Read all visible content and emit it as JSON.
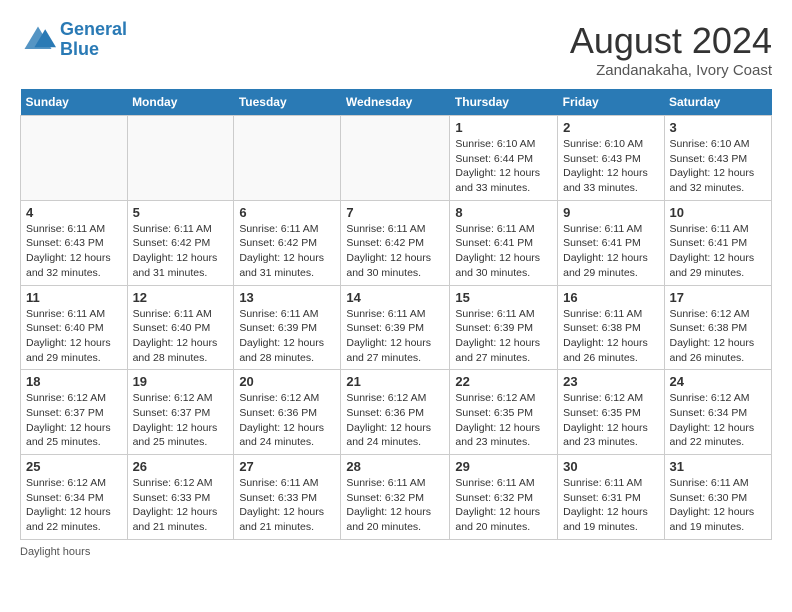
{
  "header": {
    "logo_line1": "General",
    "logo_line2": "Blue",
    "month": "August 2024",
    "location": "Zandanakaha, Ivory Coast"
  },
  "days_of_week": [
    "Sunday",
    "Monday",
    "Tuesday",
    "Wednesday",
    "Thursday",
    "Friday",
    "Saturday"
  ],
  "weeks": [
    [
      {
        "day": "",
        "info": ""
      },
      {
        "day": "",
        "info": ""
      },
      {
        "day": "",
        "info": ""
      },
      {
        "day": "",
        "info": ""
      },
      {
        "day": "1",
        "info": "Sunrise: 6:10 AM\nSunset: 6:44 PM\nDaylight: 12 hours\nand 33 minutes."
      },
      {
        "day": "2",
        "info": "Sunrise: 6:10 AM\nSunset: 6:43 PM\nDaylight: 12 hours\nand 33 minutes."
      },
      {
        "day": "3",
        "info": "Sunrise: 6:10 AM\nSunset: 6:43 PM\nDaylight: 12 hours\nand 32 minutes."
      }
    ],
    [
      {
        "day": "4",
        "info": "Sunrise: 6:11 AM\nSunset: 6:43 PM\nDaylight: 12 hours\nand 32 minutes."
      },
      {
        "day": "5",
        "info": "Sunrise: 6:11 AM\nSunset: 6:42 PM\nDaylight: 12 hours\nand 31 minutes."
      },
      {
        "day": "6",
        "info": "Sunrise: 6:11 AM\nSunset: 6:42 PM\nDaylight: 12 hours\nand 31 minutes."
      },
      {
        "day": "7",
        "info": "Sunrise: 6:11 AM\nSunset: 6:42 PM\nDaylight: 12 hours\nand 30 minutes."
      },
      {
        "day": "8",
        "info": "Sunrise: 6:11 AM\nSunset: 6:41 PM\nDaylight: 12 hours\nand 30 minutes."
      },
      {
        "day": "9",
        "info": "Sunrise: 6:11 AM\nSunset: 6:41 PM\nDaylight: 12 hours\nand 29 minutes."
      },
      {
        "day": "10",
        "info": "Sunrise: 6:11 AM\nSunset: 6:41 PM\nDaylight: 12 hours\nand 29 minutes."
      }
    ],
    [
      {
        "day": "11",
        "info": "Sunrise: 6:11 AM\nSunset: 6:40 PM\nDaylight: 12 hours\nand 29 minutes."
      },
      {
        "day": "12",
        "info": "Sunrise: 6:11 AM\nSunset: 6:40 PM\nDaylight: 12 hours\nand 28 minutes."
      },
      {
        "day": "13",
        "info": "Sunrise: 6:11 AM\nSunset: 6:39 PM\nDaylight: 12 hours\nand 28 minutes."
      },
      {
        "day": "14",
        "info": "Sunrise: 6:11 AM\nSunset: 6:39 PM\nDaylight: 12 hours\nand 27 minutes."
      },
      {
        "day": "15",
        "info": "Sunrise: 6:11 AM\nSunset: 6:39 PM\nDaylight: 12 hours\nand 27 minutes."
      },
      {
        "day": "16",
        "info": "Sunrise: 6:11 AM\nSunset: 6:38 PM\nDaylight: 12 hours\nand 26 minutes."
      },
      {
        "day": "17",
        "info": "Sunrise: 6:12 AM\nSunset: 6:38 PM\nDaylight: 12 hours\nand 26 minutes."
      }
    ],
    [
      {
        "day": "18",
        "info": "Sunrise: 6:12 AM\nSunset: 6:37 PM\nDaylight: 12 hours\nand 25 minutes."
      },
      {
        "day": "19",
        "info": "Sunrise: 6:12 AM\nSunset: 6:37 PM\nDaylight: 12 hours\nand 25 minutes."
      },
      {
        "day": "20",
        "info": "Sunrise: 6:12 AM\nSunset: 6:36 PM\nDaylight: 12 hours\nand 24 minutes."
      },
      {
        "day": "21",
        "info": "Sunrise: 6:12 AM\nSunset: 6:36 PM\nDaylight: 12 hours\nand 24 minutes."
      },
      {
        "day": "22",
        "info": "Sunrise: 6:12 AM\nSunset: 6:35 PM\nDaylight: 12 hours\nand 23 minutes."
      },
      {
        "day": "23",
        "info": "Sunrise: 6:12 AM\nSunset: 6:35 PM\nDaylight: 12 hours\nand 23 minutes."
      },
      {
        "day": "24",
        "info": "Sunrise: 6:12 AM\nSunset: 6:34 PM\nDaylight: 12 hours\nand 22 minutes."
      }
    ],
    [
      {
        "day": "25",
        "info": "Sunrise: 6:12 AM\nSunset: 6:34 PM\nDaylight: 12 hours\nand 22 minutes."
      },
      {
        "day": "26",
        "info": "Sunrise: 6:12 AM\nSunset: 6:33 PM\nDaylight: 12 hours\nand 21 minutes."
      },
      {
        "day": "27",
        "info": "Sunrise: 6:11 AM\nSunset: 6:33 PM\nDaylight: 12 hours\nand 21 minutes."
      },
      {
        "day": "28",
        "info": "Sunrise: 6:11 AM\nSunset: 6:32 PM\nDaylight: 12 hours\nand 20 minutes."
      },
      {
        "day": "29",
        "info": "Sunrise: 6:11 AM\nSunset: 6:32 PM\nDaylight: 12 hours\nand 20 minutes."
      },
      {
        "day": "30",
        "info": "Sunrise: 6:11 AM\nSunset: 6:31 PM\nDaylight: 12 hours\nand 19 minutes."
      },
      {
        "day": "31",
        "info": "Sunrise: 6:11 AM\nSunset: 6:30 PM\nDaylight: 12 hours\nand 19 minutes."
      }
    ]
  ],
  "footer": "Daylight hours"
}
